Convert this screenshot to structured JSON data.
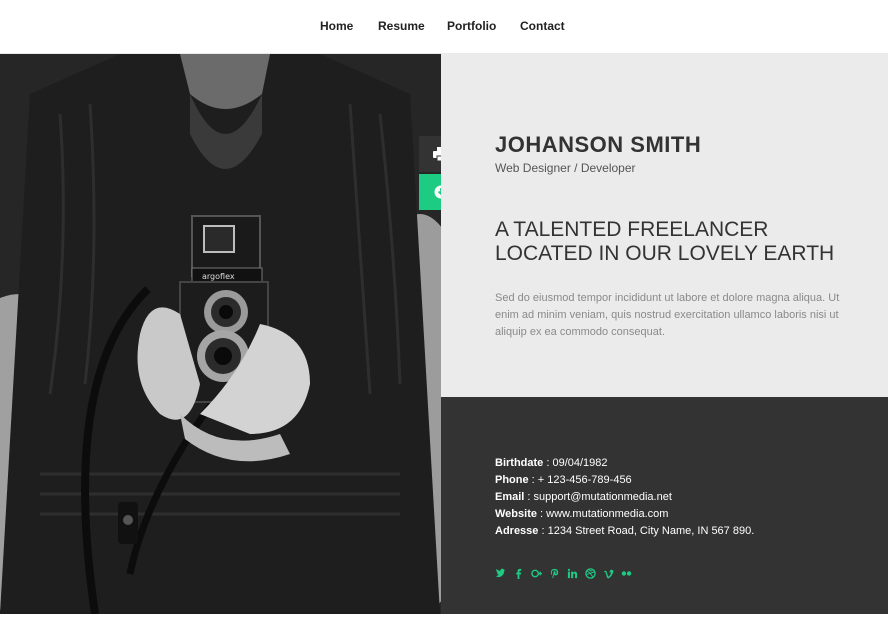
{
  "nav": {
    "items": [
      {
        "label": "Home"
      },
      {
        "label": "Resume"
      },
      {
        "label": "Portfolio"
      },
      {
        "label": "Contact"
      }
    ]
  },
  "photo": {
    "camera_brand_text": "argoflex"
  },
  "actions": {
    "print_icon": "print-icon",
    "download_icon": "download-circle-icon"
  },
  "intro": {
    "name": "JOHANSON SMITH",
    "role": "Web Designer / Developer",
    "headline_line1": "A TALENTED FREELANCER",
    "headline_line2": "LOCATED IN OUR LOVELY EARTH",
    "blurb": "Sed do eiusmod tempor incididunt ut labore et dolore magna aliqua. Ut enim ad minim veniam, quis nostrud exercitation ullamco laboris nisi ut aliquip ex ea commodo consequat."
  },
  "info": {
    "birthdate_label": "Birthdate",
    "birthdate": "09/04/1982",
    "phone_label": "Phone",
    "phone": "+ 123-456-789-456",
    "email_label": "Email",
    "email": "support@mutationmedia.net",
    "website_label": "Website",
    "website": "www.mutationmedia.com",
    "address_label": "Adresse",
    "address": "1234 Street Road, City Name, IN 567 890."
  },
  "social": [
    "twitter-icon",
    "facebook-icon",
    "google-plus-icon",
    "pinterest-icon",
    "linkedin-icon",
    "dribbble-icon",
    "vimeo-icon",
    "flickr-icon"
  ],
  "colors": {
    "accent": "#1ecb83",
    "dark_panel": "#333333",
    "light_panel": "#ebebeb"
  }
}
